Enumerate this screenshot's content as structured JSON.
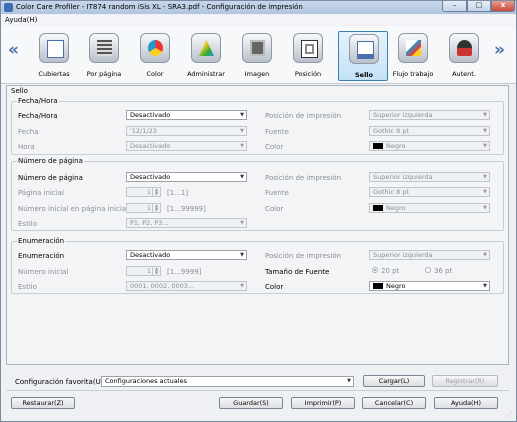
{
  "window": {
    "title": "Color Care Profiler - IT874 random iSis XL - SRA3.pdf - Configuración de impresión",
    "minimize": "–",
    "maximize": "□",
    "close": "x"
  },
  "menu": {
    "help": "Ayuda(H)"
  },
  "toolbar": {
    "prev": "«",
    "next": "»",
    "tabs": [
      {
        "label": "Cubiertas",
        "icon": "cover-icon"
      },
      {
        "label": "Por página",
        "icon": "per-page-icon"
      },
      {
        "label": "Color",
        "icon": "color-icon"
      },
      {
        "label": "Administrar",
        "icon": "manage-icon"
      },
      {
        "label": "Imagen",
        "icon": "image-icon"
      },
      {
        "label": "Posición",
        "icon": "position-icon"
      },
      {
        "label": "Sello",
        "icon": "stamp-icon",
        "selected": true
      },
      {
        "label": "Flujo trabajo",
        "icon": "workflow-icon"
      },
      {
        "label": "Autent.",
        "icon": "auth-icon"
      }
    ]
  },
  "panel": {
    "title": "Sello",
    "fecha": {
      "group": "Fecha/Hora",
      "row1_label": "Fecha/Hora",
      "row1_value": "Desactivado",
      "row2_label": "Fecha",
      "row2_value": "'12/1/23",
      "row3_label": "Hora",
      "row3_value": "Desactivado",
      "pos_label": "Posición de impresión",
      "pos_value": "Superior izquierda",
      "font_label": "Fuente",
      "font_value": "Gothic 8 pt",
      "color_label": "Color",
      "color_value": "Negro"
    },
    "pagina": {
      "group": "Número de página",
      "row1_label": "Número de página",
      "row1_value": "Desactivado",
      "row2_label": "Página inicial",
      "row2_value": "1",
      "row2_range": "[1...1]",
      "row3_label": "Número inicial en página inicial",
      "row3_value": "1",
      "row3_range": "[1...99999]",
      "row4_label": "Estilo",
      "row4_value": "P1, P2, P3...",
      "pos_label": "Posición de impresión",
      "pos_value": "Superior izquierda",
      "font_label": "Fuente",
      "font_value": "Gothic 8 pt",
      "color_label": "Color",
      "color_value": "Negro"
    },
    "enum": {
      "group": "Enumeración",
      "row1_label": "Enumeración",
      "row1_value": "Desactivado",
      "row2_label": "Número inicial",
      "row2_value": "1",
      "row2_range": "[1...9999]",
      "row3_label": "Estilo",
      "row3_value": "0001, 0002, 0003...",
      "pos_label": "Posición de impresión",
      "pos_value": "Superior izquierda",
      "size_label": "Tamaño de Fuente",
      "size_opt1": "20 pt",
      "size_opt2": "36 pt",
      "color_label": "Color",
      "color_value": "Negro"
    }
  },
  "favorites": {
    "label": "Configuración favorita(U)",
    "value": "Configuraciones actuales",
    "load": "Cargar(L)",
    "register": "Registrar(R)"
  },
  "buttons": {
    "restore": "Restaurar(Z)",
    "save": "Guardar(S)",
    "print": "Imprimir(P)",
    "cancel": "Cancelar(C)",
    "help": "Ayuda(H)"
  },
  "colors": {
    "selected_tab": "#c3e2f6",
    "accent": "#3c7fb1"
  }
}
